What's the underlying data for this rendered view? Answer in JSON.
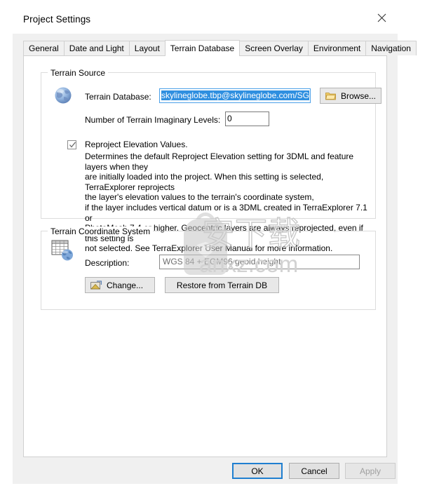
{
  "window": {
    "title": "Project Settings",
    "close_icon": "close-icon"
  },
  "tabs": [
    {
      "label": "General",
      "active": false
    },
    {
      "label": "Date and Light",
      "active": false
    },
    {
      "label": "Layout",
      "active": false
    },
    {
      "label": "Terrain Database",
      "active": true
    },
    {
      "label": "Screen Overlay",
      "active": false
    },
    {
      "label": "Environment",
      "active": false
    },
    {
      "label": "Navigation",
      "active": false
    }
  ],
  "terrain_source": {
    "legend": "Terrain Source",
    "globe_icon": "globe-icon",
    "database_label": "Terrain Database:",
    "database_value": "skylineglobe.tbp@skylineglobe.com/SG",
    "browse_button": "Browse...",
    "browse_icon": "folder-icon",
    "levels_label": "Number of Terrain Imaginary Levels:",
    "levels_value": "0",
    "reproject": {
      "checked": true,
      "label": "Reproject Elevation Values.",
      "description": "Determines the default Reproject Elevation setting for 3DML and feature layers when they\nare initially loaded into the project. When this setting is selected, TerraExplorer reprojects\nthe layer's elevation values to the terrain's coordinate system,\nif the layer includes vertical datum or is a 3DML created in TerraExplorer 7.1 or\nPhotoMesh 7.4 or higher. Geocentric layers are always reprojected, even if this setting is\nnot selected. See TerraExplorer User Manual for more information."
    }
  },
  "coordinate_system": {
    "legend": "Terrain Coordinate System",
    "grid_globe_icon": "grid-globe-icon",
    "description_label": "Description:",
    "description_value": "WGS 84 + EGM96 geoid height",
    "change_button": "Change...",
    "change_icon": "coordinate-change-icon",
    "restore_button": "Restore from Terrain DB"
  },
  "footer": {
    "ok": "OK",
    "cancel": "Cancel",
    "apply": "Apply",
    "apply_disabled": true
  },
  "watermark": {
    "chinese": "安下载",
    "url": "anxz.com"
  },
  "colors": {
    "selection_blue": "#2f8fe0",
    "focus_border": "#1f7fd0",
    "dialog_bg": "#f0f0f0",
    "page_bg": "#ffffff"
  }
}
